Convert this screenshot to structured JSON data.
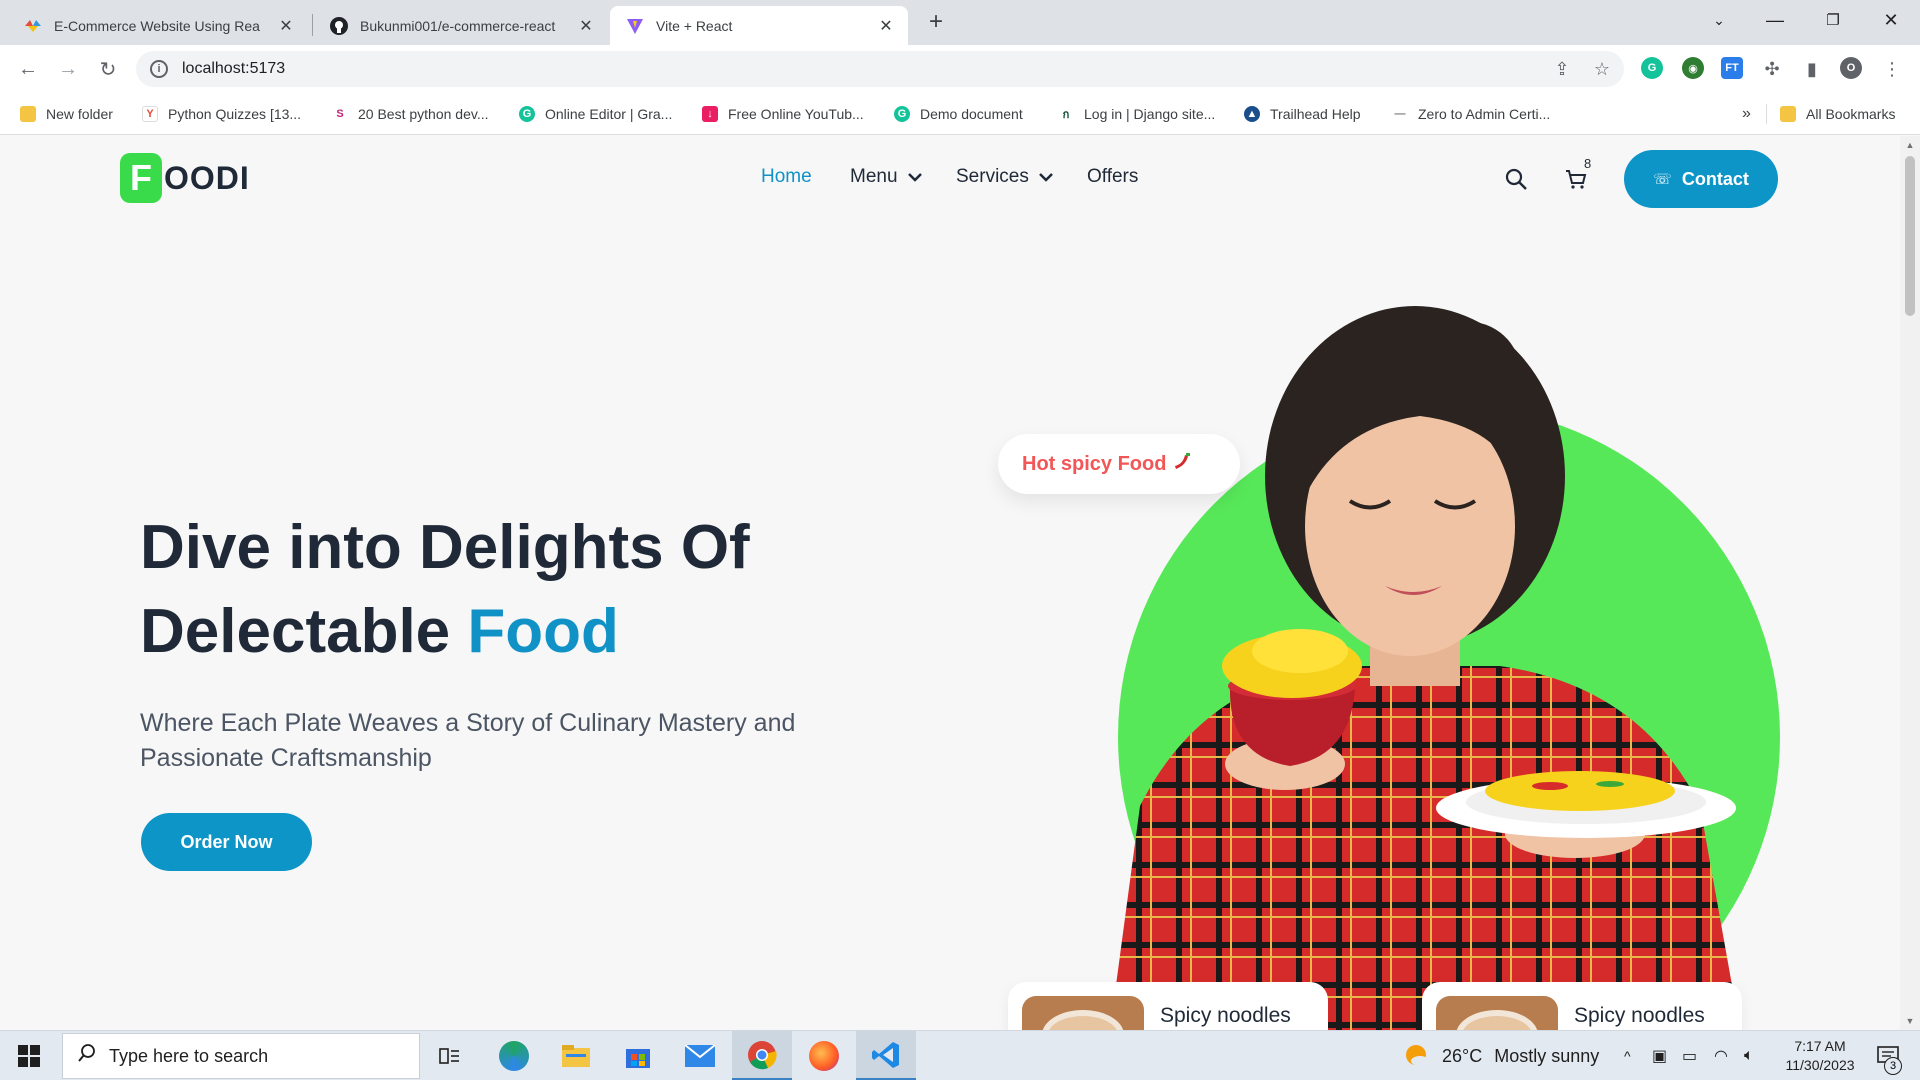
{
  "browser": {
    "tabs": [
      {
        "title": "E-Commerce Website Using Rea",
        "favicon": "multicolor-logo-icon",
        "active": false
      },
      {
        "title": "Bukunmi001/e-commerce-react",
        "favicon": "github-icon",
        "active": false
      },
      {
        "title": "Vite + React",
        "favicon": "vite-icon",
        "active": true
      }
    ],
    "url": "localhost:5173",
    "profile_initial": "O",
    "bookmarks": [
      {
        "label": "New folder",
        "icon": "folder-icon"
      },
      {
        "label": "Python Quizzes [13...",
        "icon": "yn-icon"
      },
      {
        "label": "20 Best python dev...",
        "icon": "s-icon"
      },
      {
        "label": "Online Editor | Gra...",
        "icon": "grammarly-icon"
      },
      {
        "label": "Free Online YouTub...",
        "icon": "download-icon"
      },
      {
        "label": "Demo document",
        "icon": "grammarly-icon"
      },
      {
        "label": "Log in | Django site...",
        "icon": "django-icon"
      },
      {
        "label": "Trailhead Help",
        "icon": "trailhead-icon"
      },
      {
        "label": "Zero to Admin Certi...",
        "icon": "dash-icon"
      }
    ],
    "all_bookmarks": "All Bookmarks"
  },
  "site": {
    "logo_letter": "F",
    "logo_text": "OODI",
    "nav": [
      {
        "label": "Home",
        "active": true
      },
      {
        "label": "Menu",
        "dropdown": true
      },
      {
        "label": "Services",
        "dropdown": true
      },
      {
        "label": "Offers"
      }
    ],
    "cart_count": "8",
    "contact_label": "Contact",
    "hero": {
      "title_line1": "Dive into Delights Of",
      "title_line2_plain": "Delectable ",
      "title_line2_accent": "Food",
      "subtitle": "Where Each Plate Weaves a Story of Culinary Mastery and Passionate Craftsmanship",
      "cta": "Order Now",
      "bubble_text": "Hot spicy Food",
      "cards": [
        {
          "name": "Spicy noodles"
        },
        {
          "name": "Spicy noodles"
        }
      ]
    },
    "colors": {
      "accent": "#0e95c8",
      "brand_green": "#39db4a",
      "circle_green": "#57e859",
      "bubble_red": "#f25757"
    }
  },
  "taskbar": {
    "search_placeholder": "Type here to search",
    "weather_temp": "26°C",
    "weather_desc": "Mostly sunny",
    "time": "7:17 AM",
    "date": "11/30/2023",
    "notification_count": "3"
  }
}
